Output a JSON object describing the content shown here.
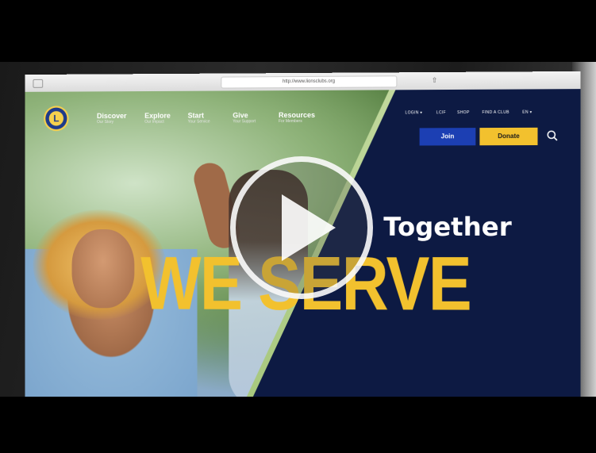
{
  "browser": {
    "url": "http://www.lionsclubs.org"
  },
  "site": {
    "logo_letter": "L",
    "nav": [
      {
        "title": "Discover",
        "sub": "Our Story"
      },
      {
        "title": "Explore",
        "sub": "Our Impact"
      },
      {
        "title": "Start",
        "sub": "Your Service"
      },
      {
        "title": "Give",
        "sub": "Your Support"
      },
      {
        "title": "Resources",
        "sub": "For Members"
      }
    ],
    "utility": [
      "LOGIN ▾",
      "LCIF",
      "SHOP",
      "FIND A CLUB",
      "EN ▾"
    ],
    "join_label": "Join",
    "donate_label": "Donate"
  },
  "hero": {
    "together": "Together",
    "we_serve": "WE SERVE"
  },
  "colors": {
    "navy": "#0d1a43",
    "join_blue": "#1c3fb3",
    "gold": "#f2c12e"
  },
  "video": {
    "play_icon": "play-icon"
  }
}
